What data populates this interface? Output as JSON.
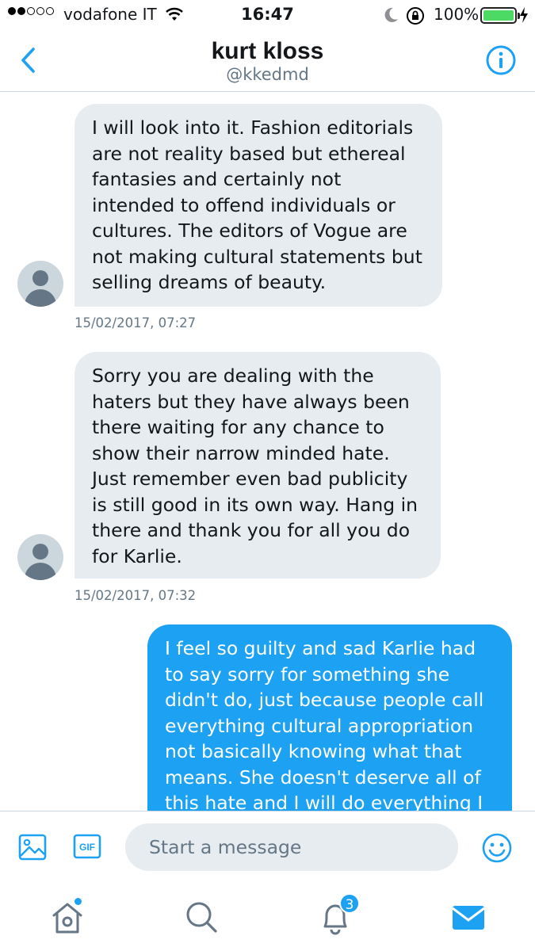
{
  "status_bar": {
    "carrier": "vodafone IT",
    "time": "16:47",
    "battery_percent": "100%",
    "battery_level": 1.0,
    "battery_color": "#4cd964"
  },
  "header": {
    "name": "kurt kloss",
    "handle": "@kkedmd",
    "back_icon": "chevron-left-icon",
    "info_icon": "info-circle-icon"
  },
  "messages": [
    {
      "direction": "incoming",
      "text": "I will look into it. Fashion editorials\nare not reality based but ethereal\nfantasies and certainly not\nintended to offend individuals or\ncultures. The editors of Vogue are\nnot making cultural statements but\nselling dreams of beauty.",
      "timestamp": "15/02/2017, 07:27"
    },
    {
      "direction": "incoming",
      "text": "Sorry you are dealing with the\nhaters but they have always been\nthere waiting for any chance to\nshow their narrow minded hate.\nJust remember even bad publicity\nis still good in its own way. Hang in\nthere and thank you for all you do\nfor Karlie.",
      "timestamp": "15/02/2017, 07:32"
    },
    {
      "direction": "outgoing",
      "text": "I feel so guilty and sad Karlie had\nto say sorry for something she\ndidn't do, just because people call\neverything cultural appropriation\nnot basically knowing what that\nmeans. She doesn't deserve all of\nthis hate and I will do everything I"
    }
  ],
  "composer": {
    "placeholder": "Start a message",
    "gif_label": "GIF",
    "media_icon": "image-icon",
    "emoji_icon": "smiley-icon"
  },
  "tab_bar": {
    "home_icon": "home-icon",
    "search_icon": "search-icon",
    "notifications_icon": "bell-icon",
    "notifications_badge": "3",
    "messages_icon": "envelope-icon"
  },
  "colors": {
    "accent": "#1da1f2",
    "incoming_bubble": "#e6ecf0",
    "secondary_text": "#657786",
    "divider": "#ccd6dd"
  }
}
